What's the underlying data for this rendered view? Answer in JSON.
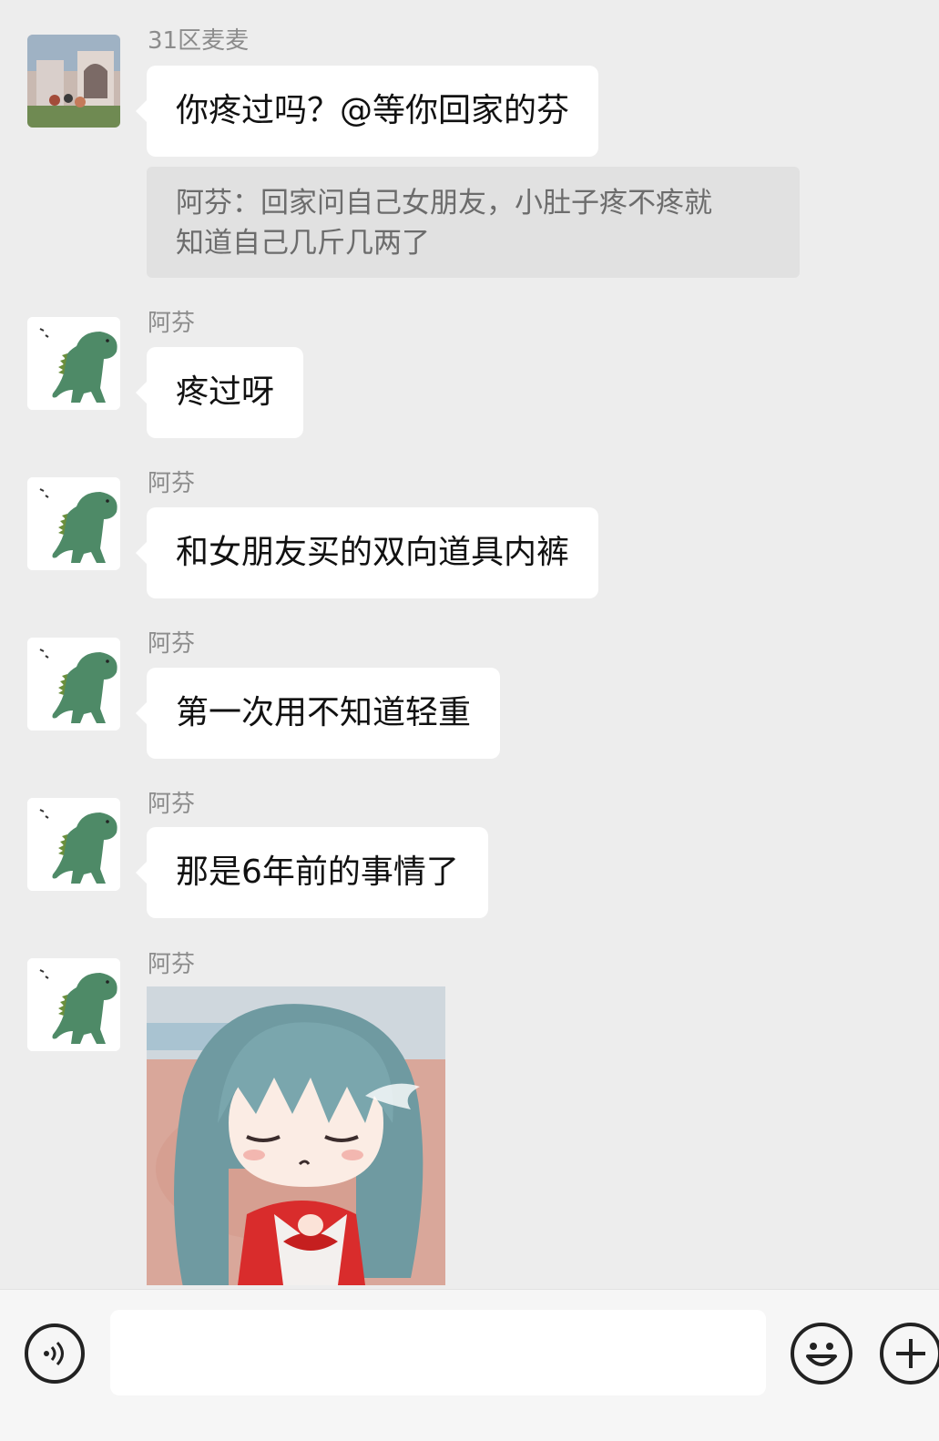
{
  "messages": [
    {
      "sender": "31区麦麦",
      "text": "你疼过吗？@等你回家的芬",
      "quote": {
        "line1": "阿芬：回家问自己女朋友，小肚子疼不疼就",
        "line2": "知道自己几斤几两了"
      }
    },
    {
      "sender": "阿芬",
      "text": "疼过呀"
    },
    {
      "sender": "阿芬",
      "text": "和女朋友买的双向道具内裤"
    },
    {
      "sender": "阿芬",
      "text": "第一次用不知道轻重"
    },
    {
      "sender": "阿芬",
      "text": "那是6年前的事情了"
    },
    {
      "sender": "阿芬",
      "sticker": "anime-girl-sticker"
    }
  ],
  "input_bar": {
    "voice_icon": "voice-icon",
    "emoji_icon": "emoji-icon",
    "plus_icon": "plus-icon",
    "placeholder": ""
  },
  "colors": {
    "background": "#ededed",
    "bubble": "#ffffff",
    "quote_bg": "#e1e1e1",
    "sender_text": "#8c8c8c",
    "dino_green": "#4e8a67"
  }
}
